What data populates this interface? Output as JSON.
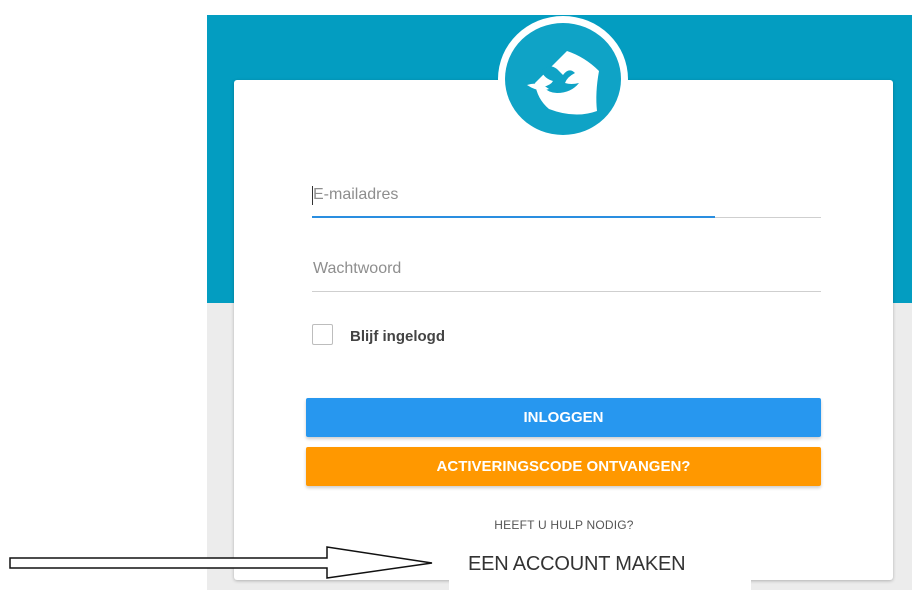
{
  "form": {
    "email_placeholder": "E-mailadres",
    "password_placeholder": "Wachtwoord",
    "remember_label": "Blijf ingelogd",
    "login_label": "INLOGGEN",
    "activation_label": "ACTIVERINGSCODE ONTVANGEN?",
    "help_label": "HEEFT U HULP NODIG?",
    "create_account_label": "EEN ACCOUNT MAKEN"
  },
  "colors": {
    "header_bg": "#039dc1",
    "login_button": "#2797ef",
    "activation_button": "#ff9800",
    "logo_bg": "#0fa3c6"
  },
  "logo": {
    "icon": "bird-in-shield-icon"
  },
  "annotation": {
    "icon": "arrow-right-icon"
  }
}
